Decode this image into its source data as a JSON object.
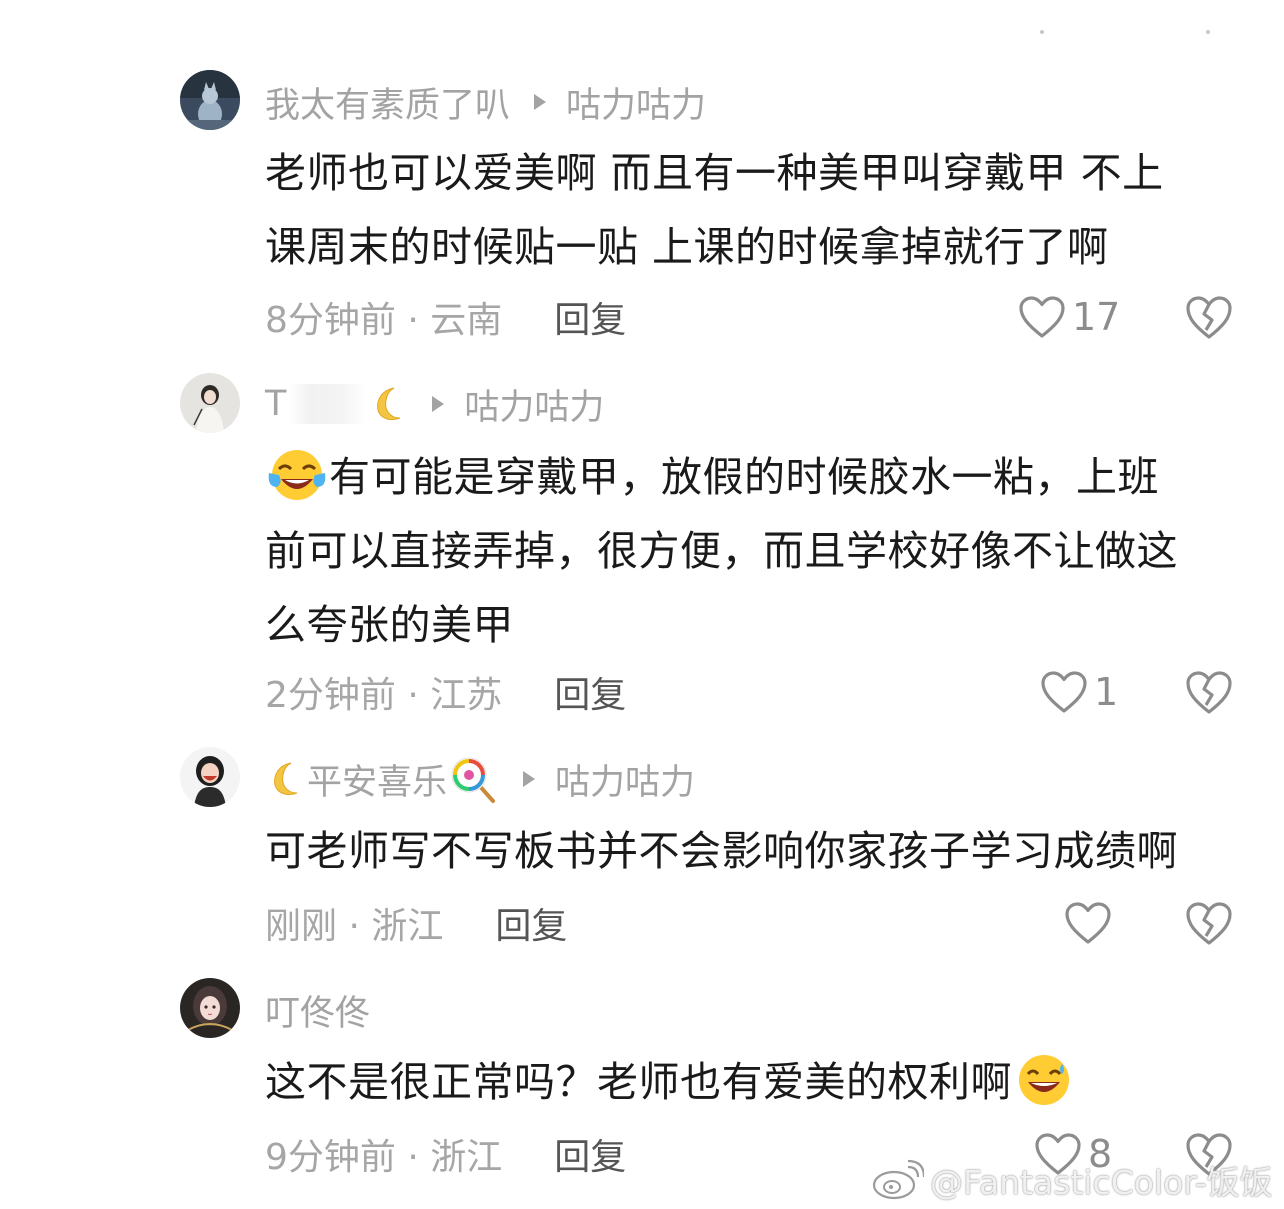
{
  "comments": [
    {
      "username": "我太有素质了叭",
      "reply_to": "咕力咕力",
      "content_lines": [
        "老师也可以爱美啊 而且有一种美甲叫穿戴甲 不上",
        "课周末的时候贴一贴 上课的时候拿掉就行了啊"
      ],
      "time_location": "8分钟前 · 云南",
      "reply_label": "回复",
      "likes": "17",
      "avatar_icon": "cat-statue-avatar"
    },
    {
      "username_prefix": "T",
      "username_suffix_emoji": "crescent-moon-icon",
      "reply_to": "咕力咕力",
      "content_lines": [
        "有可能是穿戴甲，放假的时候胶水一粘，上班",
        "前可以直接弄掉，很方便，而且学校好像不让做这",
        "么夸张的美甲"
      ],
      "content_leading_emoji": "tears-of-joy-emoji",
      "time_location": "2分钟前 · 江苏",
      "reply_label": "回复",
      "likes": "1",
      "avatar_icon": "girl-figure-avatar"
    },
    {
      "username": "平安喜乐",
      "username_prefix_emoji": "crescent-moon-icon",
      "username_suffix_emoji": "lollipop-icon",
      "reply_to": "咕力咕力",
      "content_lines": [
        "可老师写不写板书并不会影响你家孩子学习成绩啊"
      ],
      "time_location": "刚刚 · 浙江",
      "reply_label": "回复",
      "likes": "",
      "avatar_icon": "cartoon-woman-avatar"
    },
    {
      "username": "叮佟佟",
      "content_lines": [
        "这不是很正常吗？老师也有爱美的权利啊"
      ],
      "content_trailing_emoji": "grinning-squint-emoji",
      "time_location": "9分钟前 · 浙江",
      "reply_label": "回复",
      "likes": "8",
      "avatar_icon": "anime-girl-avatar"
    }
  ],
  "watermark": "@FantasticColor-饭饭",
  "colors": {
    "text_primary": "#1a1a1a",
    "text_secondary": "#a3a3a3",
    "reply_button": "#555555",
    "icon_gray": "#8c8c8c"
  }
}
